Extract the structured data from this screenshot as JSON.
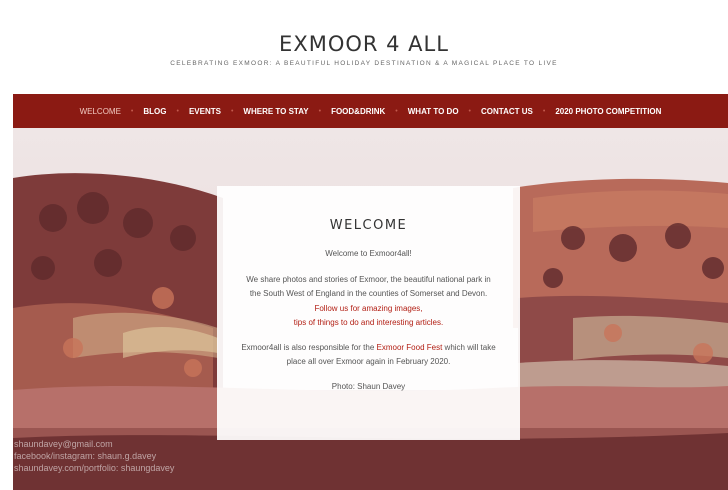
{
  "site": {
    "title": "EXMOOR 4 ALL",
    "tagline": "CELEBRATING EXMOOR: A BEAUTIFUL HOLIDAY DESTINATION & A MAGICAL PLACE TO LIVE"
  },
  "nav": {
    "items": [
      "WELCOME",
      "BLOG",
      "EVENTS",
      "WHERE TO STAY",
      "FOOD&DRINK",
      "WHAT TO DO",
      "CONTACT US",
      "2020 PHOTO COMPETITION"
    ],
    "active": "WELCOME",
    "separator": "•"
  },
  "welcome": {
    "title": "WELCOME",
    "greeting": "Welcome to Exmoor4all!",
    "para1_line1": "We share photos and stories of Exmoor, the beautiful national park in",
    "para1_line2": "the South West of England in the counties of Somerset and Devon.",
    "link1": "Follow us for amazing images,",
    "link2": "tips of things to do and interesting articles.",
    "para2_pre": "Exmoor4all is also responsible for the ",
    "para2_link": "Exmoor Food Fest",
    "para2_post": " which will take",
    "para2_line2": "place all over Exmoor again in February 2020.",
    "photo_credit": "Photo: Shaun Davey"
  },
  "watermark": {
    "line1": "shaundavey@gmail.com",
    "line2": "facebook/instagram: shaun.g.davey",
    "line3": "shaundavey.com/portfolio: shaungdavey"
  },
  "colors": {
    "nav_bg": "#8b1a13",
    "link": "#b21e13",
    "active_nav": "#f1c9c0"
  }
}
